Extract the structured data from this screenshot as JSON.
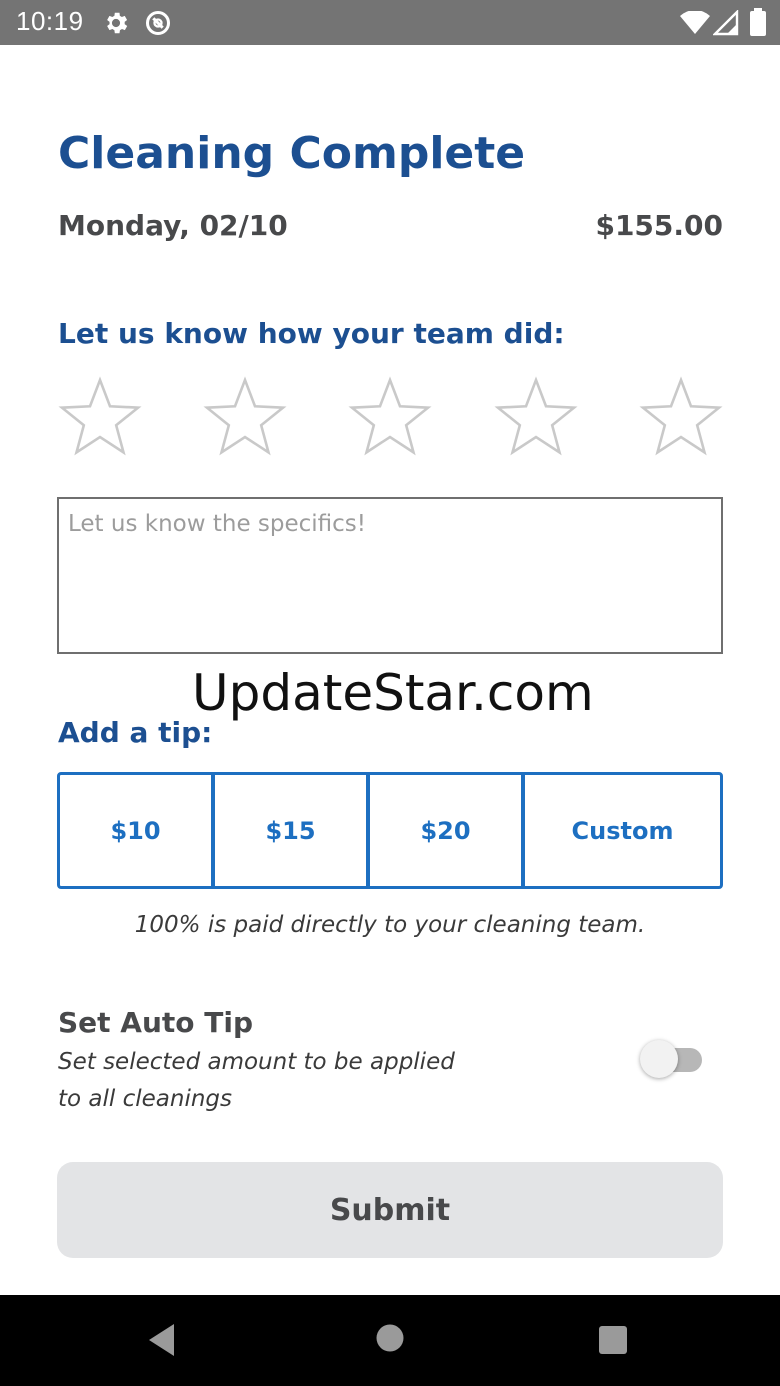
{
  "status_bar": {
    "time": "10:19",
    "left_icons": [
      "gear-icon",
      "blocked-icon"
    ],
    "right_icons": [
      "wifi-icon",
      "signal-icon",
      "battery-icon"
    ]
  },
  "header": {
    "title": "Cleaning Complete",
    "date": "Monday, 02/10",
    "price": "$155.00"
  },
  "rating": {
    "prompt": "Let us know how your team did:",
    "max": 5,
    "selected": 0,
    "star_icon": "star-outline-icon",
    "star_color": "#c9c9c9"
  },
  "feedback": {
    "placeholder": "Let us know the specifics!",
    "value": ""
  },
  "watermark": "UpdateStar.com",
  "tip": {
    "label": "Add a tip:",
    "options": [
      "$10",
      "$15",
      "$20",
      "Custom"
    ],
    "note": "100% is paid directly to your cleaning team.",
    "accent_color": "#1d6fc1"
  },
  "auto_tip": {
    "title": "Set Auto Tip",
    "description": "Set selected amount to be applied to all cleanings",
    "enabled": false
  },
  "submit": {
    "label": "Submit",
    "background": "#e3e4e6"
  },
  "colors": {
    "heading_blue": "#1c4f91",
    "text_dark": "#48494b",
    "status_bar": "#747474"
  },
  "nav_bar": {
    "buttons": [
      "back-icon",
      "home-icon",
      "recents-icon"
    ]
  }
}
